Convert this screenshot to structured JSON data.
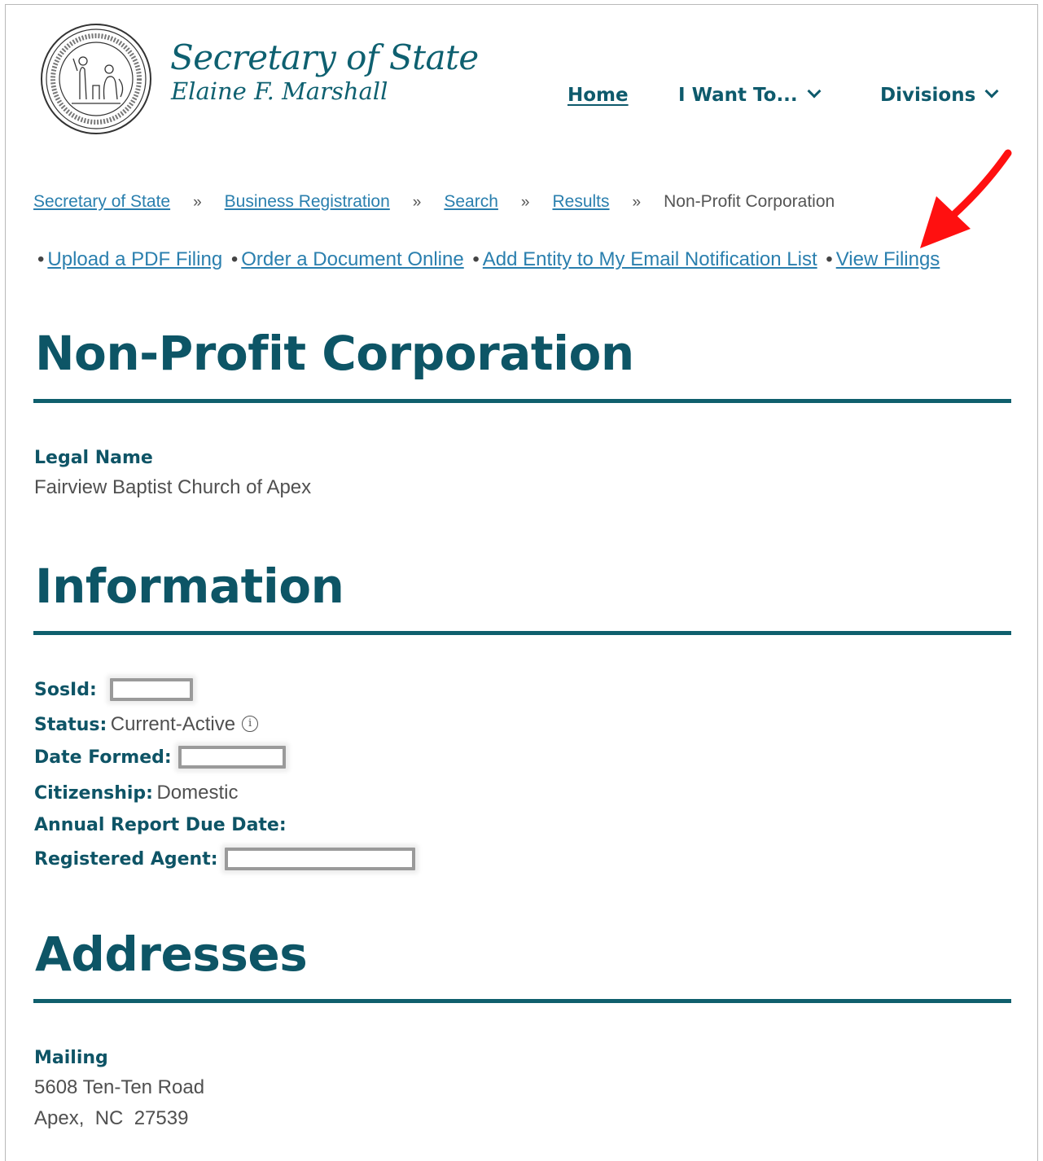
{
  "header": {
    "title": "Secretary of State",
    "subtitle": "Elaine F. Marshall",
    "nav": {
      "home": "Home",
      "i_want_to": "I Want To...",
      "divisions": "Divisions"
    }
  },
  "breadcrumb": {
    "items": [
      "Secretary of State",
      "Business Registration",
      "Search",
      "Results"
    ],
    "separator": "»",
    "current": "Non-Profit Corporation"
  },
  "actions": {
    "bullet": "•",
    "links": [
      "Upload a PDF Filing",
      "Order a Document Online",
      "Add Entity to My Email Notification List",
      "View Filings"
    ]
  },
  "page_title": "Non-Profit Corporation",
  "legal_name": {
    "label": "Legal Name",
    "value": "Fairview Baptist Church of Apex"
  },
  "information": {
    "heading": "Information",
    "fields": {
      "sosid_label": "SosId:",
      "status_label": "Status:",
      "status_value": "Current-Active",
      "date_formed_label": "Date Formed:",
      "citizenship_label": "Citizenship:",
      "citizenship_value": "Domestic",
      "annual_report_label": "Annual Report Due Date:",
      "registered_agent_label": "Registered Agent:"
    },
    "info_icon": "info-circle-icon"
  },
  "addresses": {
    "heading": "Addresses",
    "mailing": {
      "label": "Mailing",
      "line1": "5608 Ten-Ten Road",
      "line2": "Apex,  NC  27539"
    }
  },
  "colors": {
    "heading": "#0d5566",
    "link": "#2a7fae",
    "rule": "#0f5f6d",
    "annotation_arrow": "#ff0000"
  }
}
